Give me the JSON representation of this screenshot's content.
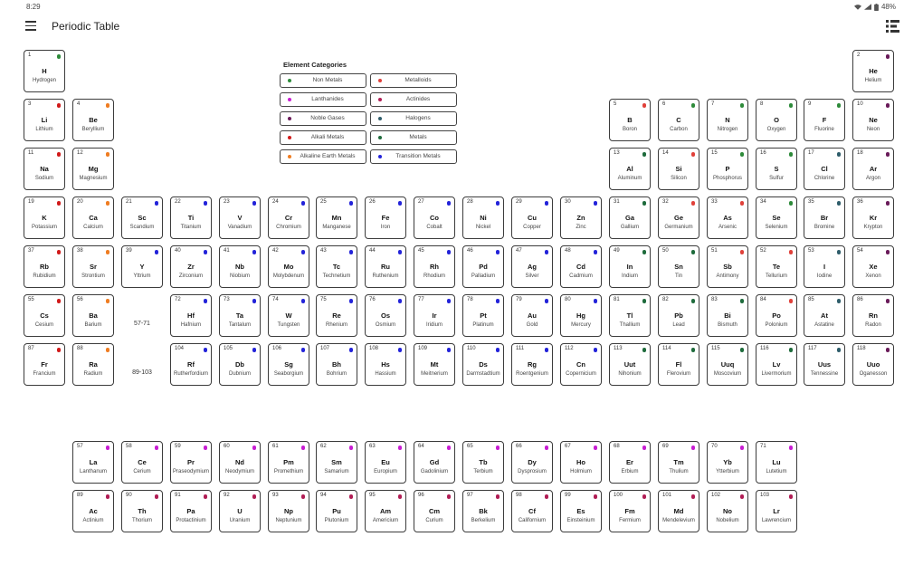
{
  "status_bar": {
    "time": "8:29",
    "battery": "48%",
    "icons": [
      "wifi-icon",
      "signal-icon",
      "battery-icon"
    ]
  },
  "app_bar": {
    "title": "Periodic Table",
    "menu_icon": "hamburger-menu-icon",
    "view_icon": "list-view-icon"
  },
  "category_colors": {
    "nonmetal": "#2e8b3a",
    "metalloid": "#e0413a",
    "lanthanide": "#c81ed2",
    "actinide": "#b11d55",
    "noble": "#6a1b5a",
    "halogen": "#2f5d6b",
    "alkali": "#d11a1a",
    "metal": "#1e6b3c",
    "alkaline": "#ef7d22",
    "transition": "#2323d9"
  },
  "legend": {
    "title": "Element Categories",
    "items": [
      {
        "label": "Non Metals",
        "cat": "nonmetal"
      },
      {
        "label": "Metalloids",
        "cat": "metalloid"
      },
      {
        "label": "Lanthanides",
        "cat": "lanthanide"
      },
      {
        "label": "Actinides",
        "cat": "actinide"
      },
      {
        "label": "Noble Gases",
        "cat": "noble"
      },
      {
        "label": "Halogens",
        "cat": "halogen"
      },
      {
        "label": "Alkali Metals",
        "cat": "alkali"
      },
      {
        "label": "Metals",
        "cat": "metal"
      },
      {
        "label": "Alkaline Earth Metals",
        "cat": "alkaline"
      },
      {
        "label": "Transition Metals",
        "cat": "transition"
      }
    ]
  },
  "placeholders": [
    {
      "row": 6,
      "col": 3,
      "text": "57-71"
    },
    {
      "row": 7,
      "col": 3,
      "text": "89-103"
    }
  ],
  "elements": [
    {
      "n": 1,
      "s": "H",
      "name": "Hydrogen",
      "row": 1,
      "col": 1,
      "cat": "nonmetal"
    },
    {
      "n": 2,
      "s": "He",
      "name": "Helium",
      "row": 1,
      "col": 18,
      "cat": "noble"
    },
    {
      "n": 3,
      "s": "Li",
      "name": "Lithium",
      "row": 2,
      "col": 1,
      "cat": "alkali"
    },
    {
      "n": 4,
      "s": "Be",
      "name": "Beryllium",
      "row": 2,
      "col": 2,
      "cat": "alkaline"
    },
    {
      "n": 5,
      "s": "B",
      "name": "Boron",
      "row": 2,
      "col": 13,
      "cat": "metalloid"
    },
    {
      "n": 6,
      "s": "C",
      "name": "Carbon",
      "row": 2,
      "col": 14,
      "cat": "nonmetal"
    },
    {
      "n": 7,
      "s": "N",
      "name": "Nitrogen",
      "row": 2,
      "col": 15,
      "cat": "nonmetal"
    },
    {
      "n": 8,
      "s": "O",
      "name": "Oxygen",
      "row": 2,
      "col": 16,
      "cat": "nonmetal"
    },
    {
      "n": 9,
      "s": "F",
      "name": "Fluorine",
      "row": 2,
      "col": 17,
      "cat": "nonmetal"
    },
    {
      "n": 10,
      "s": "Ne",
      "name": "Neon",
      "row": 2,
      "col": 18,
      "cat": "noble"
    },
    {
      "n": 11,
      "s": "Na",
      "name": "Sodium",
      "row": 3,
      "col": 1,
      "cat": "alkali"
    },
    {
      "n": 12,
      "s": "Mg",
      "name": "Magnesium",
      "row": 3,
      "col": 2,
      "cat": "alkaline"
    },
    {
      "n": 13,
      "s": "Al",
      "name": "Aluminum",
      "row": 3,
      "col": 13,
      "cat": "metal"
    },
    {
      "n": 14,
      "s": "Si",
      "name": "Silicon",
      "row": 3,
      "col": 14,
      "cat": "metalloid"
    },
    {
      "n": 15,
      "s": "P",
      "name": "Phosphorus",
      "row": 3,
      "col": 15,
      "cat": "nonmetal"
    },
    {
      "n": 16,
      "s": "S",
      "name": "Sulfur",
      "row": 3,
      "col": 16,
      "cat": "nonmetal"
    },
    {
      "n": 17,
      "s": "Cl",
      "name": "Chlorine",
      "row": 3,
      "col": 17,
      "cat": "halogen"
    },
    {
      "n": 18,
      "s": "Ar",
      "name": "Argon",
      "row": 3,
      "col": 18,
      "cat": "noble"
    },
    {
      "n": 19,
      "s": "K",
      "name": "Potassium",
      "row": 4,
      "col": 1,
      "cat": "alkali"
    },
    {
      "n": 20,
      "s": "Ca",
      "name": "Calcium",
      "row": 4,
      "col": 2,
      "cat": "alkaline"
    },
    {
      "n": 21,
      "s": "Sc",
      "name": "Scandium",
      "row": 4,
      "col": 3,
      "cat": "transition"
    },
    {
      "n": 22,
      "s": "Ti",
      "name": "Titanium",
      "row": 4,
      "col": 4,
      "cat": "transition"
    },
    {
      "n": 23,
      "s": "V",
      "name": "Vanadium",
      "row": 4,
      "col": 5,
      "cat": "transition"
    },
    {
      "n": 24,
      "s": "Cr",
      "name": "Chromium",
      "row": 4,
      "col": 6,
      "cat": "transition"
    },
    {
      "n": 25,
      "s": "Mn",
      "name": "Manganese",
      "row": 4,
      "col": 7,
      "cat": "transition"
    },
    {
      "n": 26,
      "s": "Fe",
      "name": "Iron",
      "row": 4,
      "col": 8,
      "cat": "transition"
    },
    {
      "n": 27,
      "s": "Co",
      "name": "Cobalt",
      "row": 4,
      "col": 9,
      "cat": "transition"
    },
    {
      "n": 28,
      "s": "Ni",
      "name": "Nickel",
      "row": 4,
      "col": 10,
      "cat": "transition"
    },
    {
      "n": 29,
      "s": "Cu",
      "name": "Copper",
      "row": 4,
      "col": 11,
      "cat": "transition"
    },
    {
      "n": 30,
      "s": "Zn",
      "name": "Zinc",
      "row": 4,
      "col": 12,
      "cat": "transition"
    },
    {
      "n": 31,
      "s": "Ga",
      "name": "Gallium",
      "row": 4,
      "col": 13,
      "cat": "metal"
    },
    {
      "n": 32,
      "s": "Ge",
      "name": "Germanium",
      "row": 4,
      "col": 14,
      "cat": "metalloid"
    },
    {
      "n": 33,
      "s": "As",
      "name": "Arsenic",
      "row": 4,
      "col": 15,
      "cat": "metalloid"
    },
    {
      "n": 34,
      "s": "Se",
      "name": "Selenium",
      "row": 4,
      "col": 16,
      "cat": "nonmetal"
    },
    {
      "n": 35,
      "s": "Br",
      "name": "Bromine",
      "row": 4,
      "col": 17,
      "cat": "halogen"
    },
    {
      "n": 36,
      "s": "Kr",
      "name": "Krypton",
      "row": 4,
      "col": 18,
      "cat": "noble"
    },
    {
      "n": 37,
      "s": "Rb",
      "name": "Rubidium",
      "row": 5,
      "col": 1,
      "cat": "alkali"
    },
    {
      "n": 38,
      "s": "Sr",
      "name": "Strontium",
      "row": 5,
      "col": 2,
      "cat": "alkaline"
    },
    {
      "n": 39,
      "s": "Y",
      "name": "Yttrium",
      "row": 5,
      "col": 3,
      "cat": "transition"
    },
    {
      "n": 40,
      "s": "Zr",
      "name": "Zirconium",
      "row": 5,
      "col": 4,
      "cat": "transition"
    },
    {
      "n": 41,
      "s": "Nb",
      "name": "Niobium",
      "row": 5,
      "col": 5,
      "cat": "transition"
    },
    {
      "n": 42,
      "s": "Mo",
      "name": "Molybdenum",
      "row": 5,
      "col": 6,
      "cat": "transition"
    },
    {
      "n": 43,
      "s": "Tc",
      "name": "Technetium",
      "row": 5,
      "col": 7,
      "cat": "transition"
    },
    {
      "n": 44,
      "s": "Ru",
      "name": "Ruthenium",
      "row": 5,
      "col": 8,
      "cat": "transition"
    },
    {
      "n": 45,
      "s": "Rh",
      "name": "Rhodium",
      "row": 5,
      "col": 9,
      "cat": "transition"
    },
    {
      "n": 46,
      "s": "Pd",
      "name": "Palladium",
      "row": 5,
      "col": 10,
      "cat": "transition"
    },
    {
      "n": 47,
      "s": "Ag",
      "name": "Silver",
      "row": 5,
      "col": 11,
      "cat": "transition"
    },
    {
      "n": 48,
      "s": "Cd",
      "name": "Cadmium",
      "row": 5,
      "col": 12,
      "cat": "transition"
    },
    {
      "n": 49,
      "s": "In",
      "name": "Indium",
      "row": 5,
      "col": 13,
      "cat": "metal"
    },
    {
      "n": 50,
      "s": "Sn",
      "name": "Tin",
      "row": 5,
      "col": 14,
      "cat": "metal"
    },
    {
      "n": 51,
      "s": "Sb",
      "name": "Antimony",
      "row": 5,
      "col": 15,
      "cat": "metalloid"
    },
    {
      "n": 52,
      "s": "Te",
      "name": "Tellurium",
      "row": 5,
      "col": 16,
      "cat": "metalloid"
    },
    {
      "n": 53,
      "s": "I",
      "name": "Iodine",
      "row": 5,
      "col": 17,
      "cat": "halogen"
    },
    {
      "n": 54,
      "s": "Xe",
      "name": "Xenon",
      "row": 5,
      "col": 18,
      "cat": "noble"
    },
    {
      "n": 55,
      "s": "Cs",
      "name": "Cesium",
      "row": 6,
      "col": 1,
      "cat": "alkali"
    },
    {
      "n": 56,
      "s": "Ba",
      "name": "Barium",
      "row": 6,
      "col": 2,
      "cat": "alkaline"
    },
    {
      "n": 72,
      "s": "Hf",
      "name": "Hafnium",
      "row": 6,
      "col": 4,
      "cat": "transition"
    },
    {
      "n": 73,
      "s": "Ta",
      "name": "Tantalum",
      "row": 6,
      "col": 5,
      "cat": "transition"
    },
    {
      "n": 74,
      "s": "W",
      "name": "Tungsten",
      "row": 6,
      "col": 6,
      "cat": "transition"
    },
    {
      "n": 75,
      "s": "Re",
      "name": "Rhenium",
      "row": 6,
      "col": 7,
      "cat": "transition"
    },
    {
      "n": 76,
      "s": "Os",
      "name": "Osmium",
      "row": 6,
      "col": 8,
      "cat": "transition"
    },
    {
      "n": 77,
      "s": "Ir",
      "name": "Iridium",
      "row": 6,
      "col": 9,
      "cat": "transition"
    },
    {
      "n": 78,
      "s": "Pt",
      "name": "Platinum",
      "row": 6,
      "col": 10,
      "cat": "transition"
    },
    {
      "n": 79,
      "s": "Au",
      "name": "Gold",
      "row": 6,
      "col": 11,
      "cat": "transition"
    },
    {
      "n": 80,
      "s": "Hg",
      "name": "Mercury",
      "row": 6,
      "col": 12,
      "cat": "transition"
    },
    {
      "n": 81,
      "s": "Tl",
      "name": "Thallium",
      "row": 6,
      "col": 13,
      "cat": "metal"
    },
    {
      "n": 82,
      "s": "Pb",
      "name": "Lead",
      "row": 6,
      "col": 14,
      "cat": "metal"
    },
    {
      "n": 83,
      "s": "Bi",
      "name": "Bismuth",
      "row": 6,
      "col": 15,
      "cat": "metal"
    },
    {
      "n": 84,
      "s": "Po",
      "name": "Polonium",
      "row": 6,
      "col": 16,
      "cat": "metalloid"
    },
    {
      "n": 85,
      "s": "At",
      "name": "Astatine",
      "row": 6,
      "col": 17,
      "cat": "halogen"
    },
    {
      "n": 86,
      "s": "Rn",
      "name": "Radon",
      "row": 6,
      "col": 18,
      "cat": "noble"
    },
    {
      "n": 87,
      "s": "Fr",
      "name": "Francium",
      "row": 7,
      "col": 1,
      "cat": "alkali"
    },
    {
      "n": 88,
      "s": "Ra",
      "name": "Radium",
      "row": 7,
      "col": 2,
      "cat": "alkaline"
    },
    {
      "n": 104,
      "s": "Rf",
      "name": "Rutherfordium",
      "row": 7,
      "col": 4,
      "cat": "transition"
    },
    {
      "n": 105,
      "s": "Db",
      "name": "Dubnium",
      "row": 7,
      "col": 5,
      "cat": "transition"
    },
    {
      "n": 106,
      "s": "Sg",
      "name": "Seaborgium",
      "row": 7,
      "col": 6,
      "cat": "transition"
    },
    {
      "n": 107,
      "s": "Bh",
      "name": "Bohrium",
      "row": 7,
      "col": 7,
      "cat": "transition"
    },
    {
      "n": 108,
      "s": "Hs",
      "name": "Hassium",
      "row": 7,
      "col": 8,
      "cat": "transition"
    },
    {
      "n": 109,
      "s": "Mt",
      "name": "Meitnerium",
      "row": 7,
      "col": 9,
      "cat": "transition"
    },
    {
      "n": 110,
      "s": "Ds",
      "name": "Darmstadtium",
      "row": 7,
      "col": 10,
      "cat": "transition"
    },
    {
      "n": 111,
      "s": "Rg",
      "name": "Roentgenium",
      "row": 7,
      "col": 11,
      "cat": "transition"
    },
    {
      "n": 112,
      "s": "Cn",
      "name": "Copernicium",
      "row": 7,
      "col": 12,
      "cat": "transition"
    },
    {
      "n": 113,
      "s": "Uut",
      "name": "Nihonium",
      "row": 7,
      "col": 13,
      "cat": "metal"
    },
    {
      "n": 114,
      "s": "Fl",
      "name": "Flerovium",
      "row": 7,
      "col": 14,
      "cat": "metal"
    },
    {
      "n": 115,
      "s": "Uuq",
      "name": "Moscovium",
      "row": 7,
      "col": 15,
      "cat": "metal"
    },
    {
      "n": 116,
      "s": "Lv",
      "name": "Livermorium",
      "row": 7,
      "col": 16,
      "cat": "metal"
    },
    {
      "n": 117,
      "s": "Uus",
      "name": "Tennessine",
      "row": 7,
      "col": 17,
      "cat": "halogen"
    },
    {
      "n": 118,
      "s": "Uuo",
      "name": "Oganesson",
      "row": 7,
      "col": 18,
      "cat": "noble"
    },
    {
      "n": 57,
      "s": "La",
      "name": "Lanthanum",
      "row": 9,
      "col": 2,
      "cat": "lanthanide"
    },
    {
      "n": 58,
      "s": "Ce",
      "name": "Cerium",
      "row": 9,
      "col": 3,
      "cat": "lanthanide"
    },
    {
      "n": 59,
      "s": "Pr",
      "name": "Praseodymium",
      "row": 9,
      "col": 4,
      "cat": "lanthanide"
    },
    {
      "n": 60,
      "s": "Nd",
      "name": "Neodymium",
      "row": 9,
      "col": 5,
      "cat": "lanthanide"
    },
    {
      "n": 61,
      "s": "Pm",
      "name": "Promethium",
      "row": 9,
      "col": 6,
      "cat": "lanthanide"
    },
    {
      "n": 62,
      "s": "Sm",
      "name": "Samarium",
      "row": 9,
      "col": 7,
      "cat": "lanthanide"
    },
    {
      "n": 63,
      "s": "Eu",
      "name": "Europium",
      "row": 9,
      "col": 8,
      "cat": "lanthanide"
    },
    {
      "n": 64,
      "s": "Gd",
      "name": "Gadolinium",
      "row": 9,
      "col": 9,
      "cat": "lanthanide"
    },
    {
      "n": 65,
      "s": "Tb",
      "name": "Terbium",
      "row": 9,
      "col": 10,
      "cat": "lanthanide"
    },
    {
      "n": 66,
      "s": "Dy",
      "name": "Dysprosium",
      "row": 9,
      "col": 11,
      "cat": "lanthanide"
    },
    {
      "n": 67,
      "s": "Ho",
      "name": "Holmium",
      "row": 9,
      "col": 12,
      "cat": "lanthanide"
    },
    {
      "n": 68,
      "s": "Er",
      "name": "Erbium",
      "row": 9,
      "col": 13,
      "cat": "lanthanide"
    },
    {
      "n": 69,
      "s": "Tm",
      "name": "Thulium",
      "row": 9,
      "col": 14,
      "cat": "lanthanide"
    },
    {
      "n": 70,
      "s": "Yb",
      "name": "Ytterbium",
      "row": 9,
      "col": 15,
      "cat": "lanthanide"
    },
    {
      "n": 71,
      "s": "Lu",
      "name": "Lutetium",
      "row": 9,
      "col": 16,
      "cat": "lanthanide"
    },
    {
      "n": 89,
      "s": "Ac",
      "name": "Actinium",
      "row": 10,
      "col": 2,
      "cat": "actinide"
    },
    {
      "n": 90,
      "s": "Th",
      "name": "Thorium",
      "row": 10,
      "col": 3,
      "cat": "actinide"
    },
    {
      "n": 91,
      "s": "Pa",
      "name": "Protactinium",
      "row": 10,
      "col": 4,
      "cat": "actinide"
    },
    {
      "n": 92,
      "s": "U",
      "name": "Uranium",
      "row": 10,
      "col": 5,
      "cat": "actinide"
    },
    {
      "n": 93,
      "s": "Np",
      "name": "Neptunium",
      "row": 10,
      "col": 6,
      "cat": "actinide"
    },
    {
      "n": 94,
      "s": "Pu",
      "name": "Plutonium",
      "row": 10,
      "col": 7,
      "cat": "actinide"
    },
    {
      "n": 95,
      "s": "Am",
      "name": "Americium",
      "row": 10,
      "col": 8,
      "cat": "actinide"
    },
    {
      "n": 96,
      "s": "Cm",
      "name": "Curium",
      "row": 10,
      "col": 9,
      "cat": "actinide"
    },
    {
      "n": 97,
      "s": "Bk",
      "name": "Berkelium",
      "row": 10,
      "col": 10,
      "cat": "actinide"
    },
    {
      "n": 98,
      "s": "Cf",
      "name": "Californium",
      "row": 10,
      "col": 11,
      "cat": "actinide"
    },
    {
      "n": 99,
      "s": "Es",
      "name": "Einsteinium",
      "row": 10,
      "col": 12,
      "cat": "actinide"
    },
    {
      "n": 100,
      "s": "Fm",
      "name": "Fermium",
      "row": 10,
      "col": 13,
      "cat": "actinide"
    },
    {
      "n": 101,
      "s": "Md",
      "name": "Mendelevium",
      "row": 10,
      "col": 14,
      "cat": "actinide"
    },
    {
      "n": 102,
      "s": "No",
      "name": "Nobelium",
      "row": 10,
      "col": 15,
      "cat": "actinide"
    },
    {
      "n": 103,
      "s": "Lr",
      "name": "Lawrencium",
      "row": 10,
      "col": 16,
      "cat": "actinide"
    }
  ]
}
